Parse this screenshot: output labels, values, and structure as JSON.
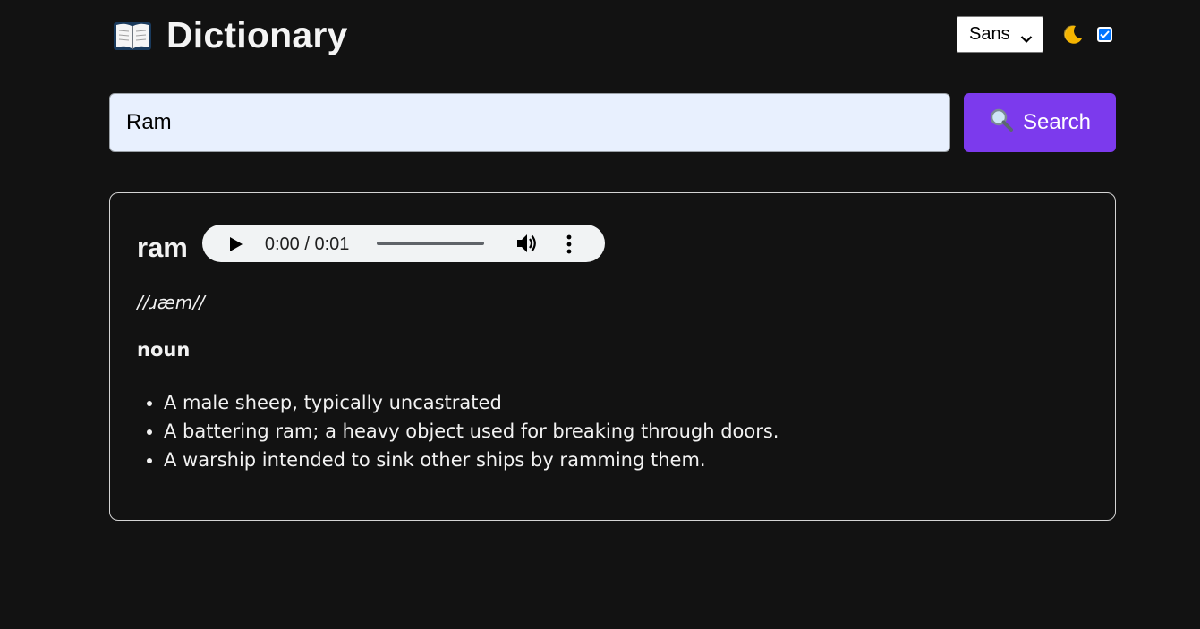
{
  "header": {
    "title": "Dictionary",
    "font_select": {
      "selected": "Sans"
    },
    "theme_toggle": {
      "checked": true
    }
  },
  "search": {
    "input_value": "Ram",
    "button_label": "Search"
  },
  "result": {
    "word": "ram",
    "audio": {
      "time_display": "0:00 / 0:01"
    },
    "phonetic": "//ɹæm//",
    "part_of_speech": "noun",
    "definitions": [
      "A male sheep, typically uncastrated",
      "A battering ram; a heavy object used for breaking through doors.",
      "A warship intended to sink other ships by ramming them."
    ]
  },
  "colors": {
    "background": "#121212",
    "accent": "#7c3aed",
    "input_bg": "#e8f0fe",
    "card_border": "#d4d4d4",
    "checkbox": "#0075ff"
  },
  "icons": {
    "brand": "open-book-icon",
    "search": "magnifier-icon",
    "theme": "moon-icon"
  }
}
